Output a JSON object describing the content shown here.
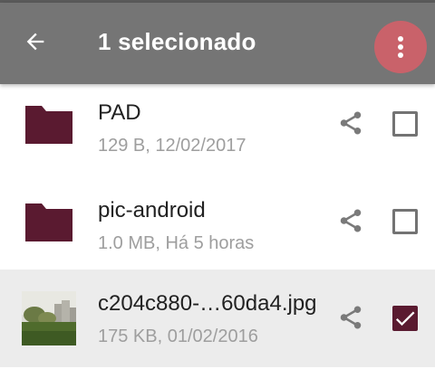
{
  "appbar": {
    "title": "1 selecionado",
    "back_icon": "arrow-back-icon",
    "more_icon": "more-vert-icon",
    "bar_color": "#757575",
    "ripple_color": "#c9626a"
  },
  "files": [
    {
      "name": "PAD",
      "meta": "129 B, 12/02/2017",
      "type": "folder",
      "checked": false
    },
    {
      "name": "pic-android",
      "meta": "1.0 MB, Há 5 horas",
      "type": "folder",
      "checked": false
    },
    {
      "name": "c204c880-…60da4.jpg",
      "meta": "175 KB, 01/02/2016",
      "type": "image",
      "checked": true
    }
  ],
  "colors": {
    "folder": "#5a1a30",
    "checkbox_checked": "#5a1a30",
    "selected_row_bg": "#ececec"
  }
}
